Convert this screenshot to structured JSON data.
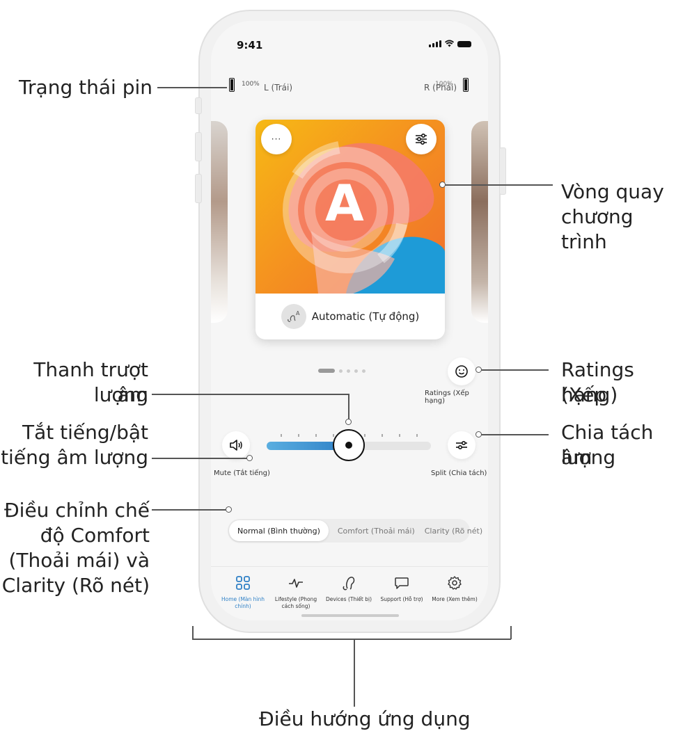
{
  "status": {
    "time": "9:41"
  },
  "battery": {
    "left_percent": "100%",
    "left_label": "L (Trái)",
    "right_percent": "100%",
    "right_label": "R (Phải)"
  },
  "program": {
    "more_label": "···",
    "name": "Automatic (Tự động)",
    "letter": "A"
  },
  "ratings": {
    "label": "Ratings (Xếp hạng)"
  },
  "mute": {
    "label": "Mute (Tắt tiếng)"
  },
  "split": {
    "label": "Split (Chia tách)"
  },
  "volume": {
    "level": 0.5
  },
  "modes": [
    {
      "label": "Normal (Bình thường)",
      "active": true
    },
    {
      "label": "Comfort (Thoải mái)",
      "active": false
    },
    {
      "label": "Clarity (Rõ nét)",
      "active": false
    }
  ],
  "nav": [
    {
      "label": "Home (Màn hình chính)",
      "icon": "grid-icon",
      "active": true
    },
    {
      "label": "Lifestyle (Phong cách sống)",
      "icon": "pulse-icon",
      "active": false
    },
    {
      "label": "Devices (Thiết bị)",
      "icon": "hearing-aid-icon",
      "active": false
    },
    {
      "label": "Support (Hỗ trợ)",
      "icon": "chat-icon",
      "active": false
    },
    {
      "label": "More (Xem thêm)",
      "icon": "gear-icon",
      "active": false
    }
  ],
  "annotations": {
    "battery": "Trạng thái pin",
    "carousel_1": "Vòng quay",
    "carousel_2": "chương trình",
    "slider_1": "Thanh trượt âm",
    "slider_2": "lượng",
    "ratings_1": "Ratings (Xếp",
    "ratings_2": "hạng)",
    "split_1": "Chia tách âm",
    "split_2": "lượng",
    "mute_1": "Tắt tiếng/bật",
    "mute_2": "tiếng âm lượng",
    "mode_1": "Điều chỉnh  chế",
    "mode_2": "độ Comfort",
    "mode_3": "(Thoải mái) và",
    "mode_4": "Clarity (Rõ nét)",
    "nav": "Điều hướng ứng dụng"
  },
  "colors": {
    "accent": "#2f80c6",
    "orange": "#f5941f",
    "yellow": "#f6b915"
  }
}
